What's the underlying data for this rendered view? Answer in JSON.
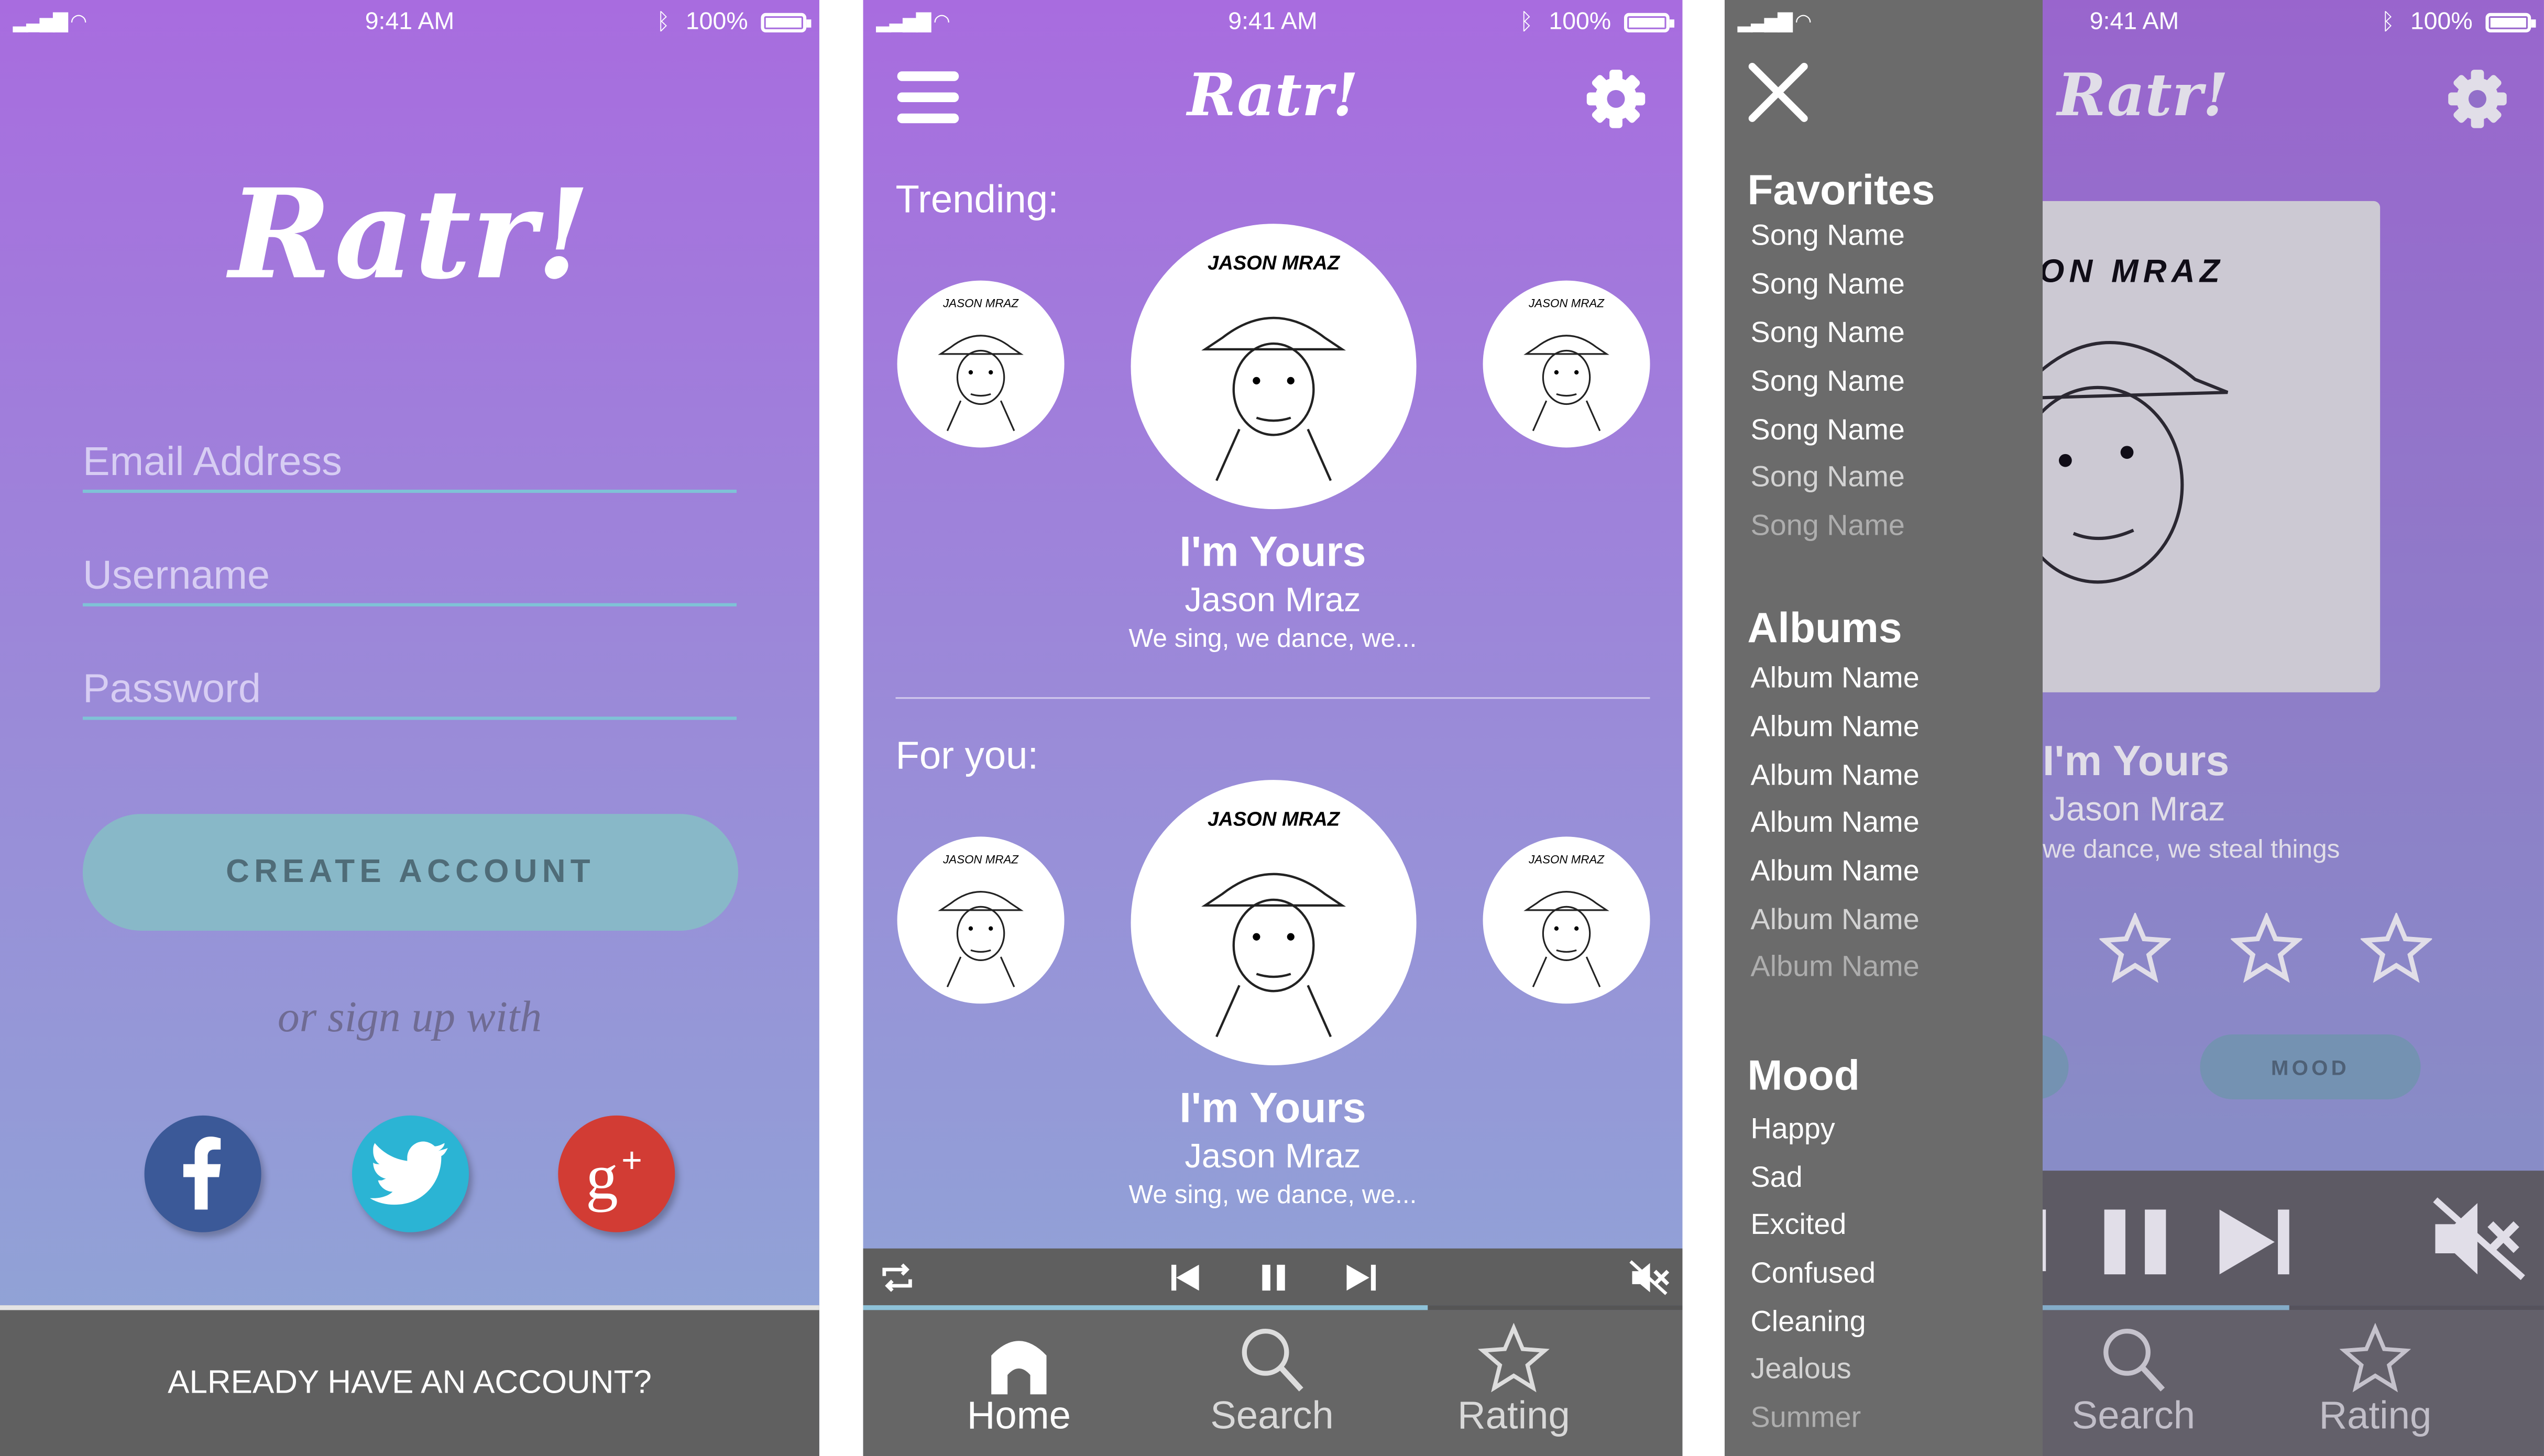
{
  "status_bar": {
    "time": "9:41 AM",
    "battery": "100%"
  },
  "app": {
    "logo": "Ratr!"
  },
  "signup": {
    "email_placeholder": "Email Address",
    "username_placeholder": "Username",
    "password_placeholder": "Password",
    "create_account": "CREATE ACCOUNT",
    "or_sign_up_with": "or sign up with",
    "social": [
      "facebook-icon",
      "twitter-icon",
      "google-plus-icon"
    ],
    "social_colors": [
      "#3b5998",
      "#2bb4d4",
      "#d23c34"
    ],
    "already_have_account": "ALREADY HAVE AN ACCOUNT?"
  },
  "home": {
    "trending_label": "Trending:",
    "for_you_label": "For you:",
    "album_art_text": "JASON MRAZ",
    "trending": {
      "title": "I'm Yours",
      "artist": "Jason Mraz",
      "album": "We sing, we dance, we..."
    },
    "for_you": {
      "title": "I'm Yours",
      "artist": "Jason Mraz",
      "album": "We sing, we dance, we..."
    }
  },
  "tabs": {
    "home": "Home",
    "search": "Search",
    "rating": "Rating"
  },
  "menu": {
    "favorites_heading": "Favorites",
    "favorites": [
      "Song Name",
      "Song Name",
      "Song Name",
      "Song Name",
      "Song Name",
      "Song Name",
      "Song Name"
    ],
    "albums_heading": "Albums",
    "albums": [
      "Album Name",
      "Album Name",
      "Album Name",
      "Album Name",
      "Album Name",
      "Album Name",
      "Album Name"
    ],
    "mood_heading": "Mood",
    "moods": [
      "Happy",
      "Sad",
      "Excited",
      "Confused",
      "Cleaning",
      "Jealous",
      "Summer"
    ]
  },
  "rating_screen": {
    "title": "I'm Yours",
    "artist": "Jason Mraz",
    "album": "we dance, we steal things",
    "mood_button": "MOOD",
    "art_text": "ASON MRAZ"
  },
  "colors": {
    "gradient_top": "#a86cdf",
    "gradient_bottom": "#8ea8d6",
    "bar": "#606060",
    "accent": "#88b8c8"
  }
}
